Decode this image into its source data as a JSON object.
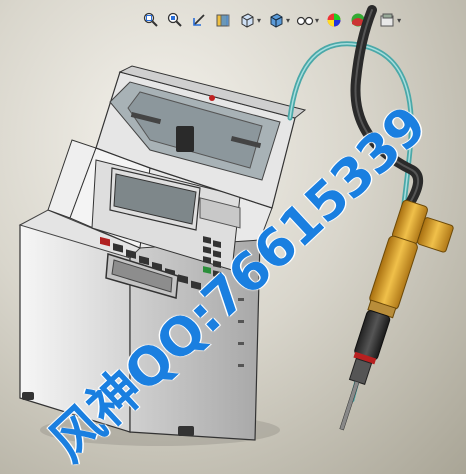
{
  "toolbar": {
    "tools": [
      {
        "name": "zoom-to-fit-icon"
      },
      {
        "name": "zoom-to-area-icon"
      },
      {
        "name": "previous-view-icon"
      },
      {
        "name": "section-view-icon"
      },
      {
        "name": "view-orientation-icon",
        "dropdown": true
      },
      {
        "name": "display-style-icon",
        "dropdown": true
      },
      {
        "name": "hide-show-items-icon",
        "dropdown": true
      },
      {
        "name": "edit-appearance-icon"
      },
      {
        "name": "apply-scene-icon",
        "dropdown": true
      },
      {
        "name": "view-settings-icon",
        "dropdown": true
      }
    ]
  },
  "watermark": {
    "text": "风神QQ:76615339",
    "color": "#1a7fe0"
  },
  "model": {
    "body_color": "#eeeeee",
    "panel_color": "#d8d8d8",
    "cable_teal": "#4aa8a8",
    "cable_dark": "#2a2a2a",
    "screwdriver_gold": "#d9a126"
  }
}
